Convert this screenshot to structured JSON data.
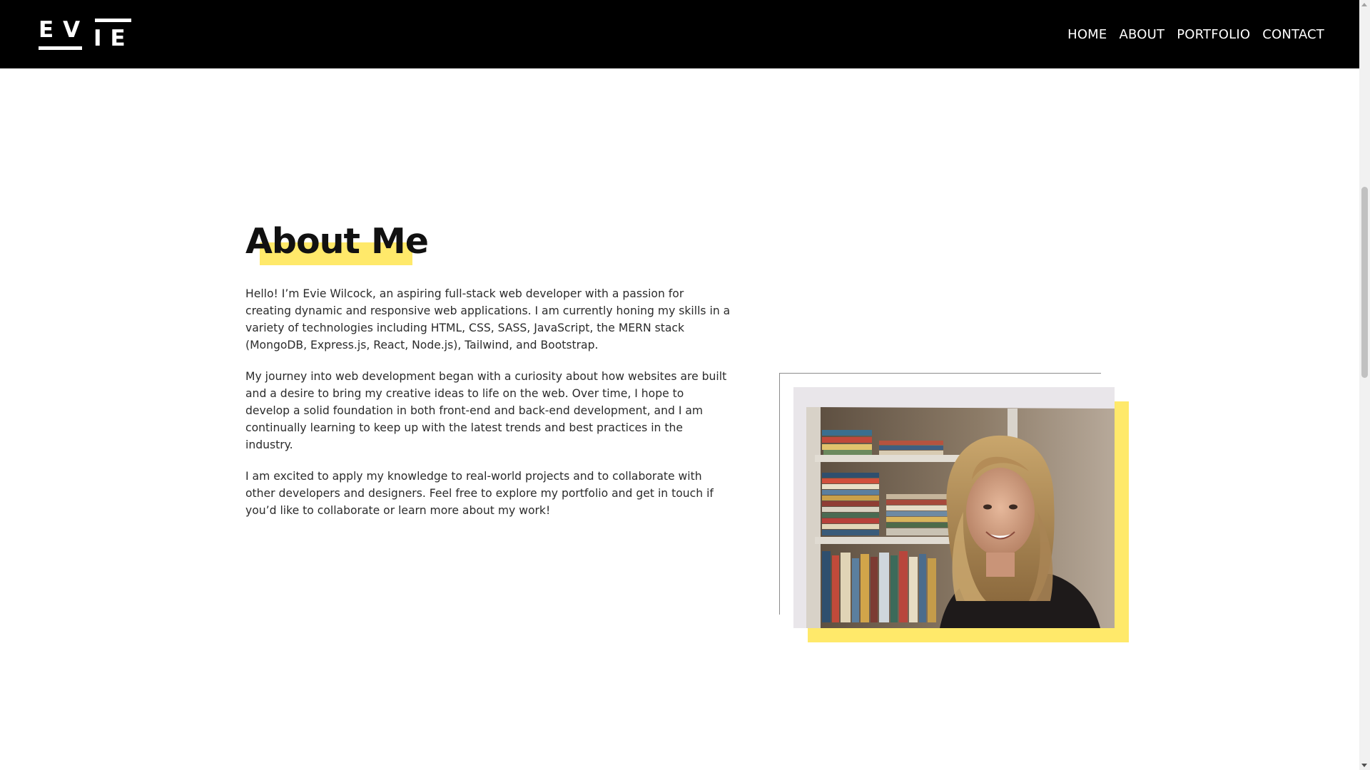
{
  "nav": {
    "logo_text_top": "EV",
    "logo_text_bottom": "IE",
    "links": [
      {
        "label": "HOME"
      },
      {
        "label": "ABOUT"
      },
      {
        "label": "PORTFOLIO"
      },
      {
        "label": "CONTACT"
      }
    ]
  },
  "about": {
    "heading": "About Me",
    "paragraphs": [
      "Hello! I’m Evie Wilcock, an aspiring full-stack web developer with a passion for creating dynamic and responsive web applications. I am currently honing my skills in a variety of technologies including HTML, CSS, SASS, JavaScript, the MERN stack (MongoDB, Express.js, React, Node.js), Tailwind, and Bootstrap.",
      "My journey into web development began with a curiosity about how websites are built and a desire to bring my creative ideas to life on the web. Over time, I hope to develop a solid foundation in both front-end and back-end development, and I am continually learning to keep up with the latest trends and best practices in the industry.",
      "I am excited to apply my knowledge to real-world projects and to collaborate with other developers and designers. Feel free to explore my portfolio and get in touch if you’d like to collaborate or learn more about my work!"
    ]
  },
  "colors": {
    "accent_yellow": "#ffe96a",
    "navbar_bg": "#000000",
    "text": "#2b2b2b"
  },
  "photo": {
    "subject": "portrait-photo"
  }
}
